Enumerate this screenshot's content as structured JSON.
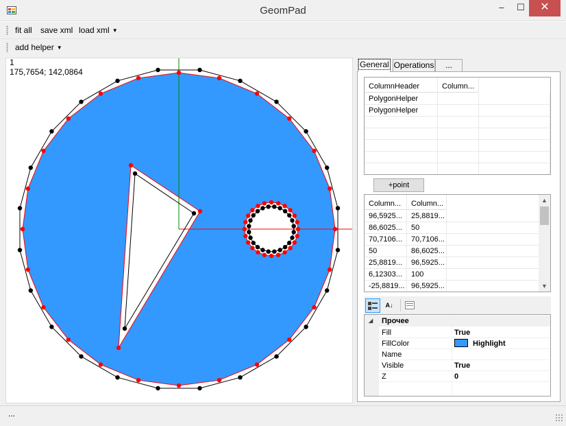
{
  "window": {
    "title": "GeomPad",
    "min_glyph": "–",
    "max_glyph": "☐",
    "close_glyph": "✕"
  },
  "toolbar1": {
    "fit_all": "fit all",
    "save_xml": "save xml",
    "load_xml": "load xml",
    "dropdown_glyph": "▼"
  },
  "toolbar2": {
    "add_helper": "add helper",
    "dropdown_glyph": "▼"
  },
  "canvas": {
    "info_line1": "1",
    "info_line2": "175,7654; 142,0864",
    "fill_color": "#3399ff",
    "outline_color": "#ff0000",
    "point_red": "#ff0000",
    "point_black": "#000000",
    "axis_x_color": "#ff0000",
    "axis_y_color": "#008000"
  },
  "tabs": [
    {
      "label": "General",
      "active": true
    },
    {
      "label": "Operations",
      "active": false
    },
    {
      "label": "...",
      "active": false
    }
  ],
  "helpers_grid": {
    "columns": [
      "ColumnHeader",
      "Column..."
    ],
    "rows": [
      [
        "PolygonHelper",
        ""
      ],
      [
        "PolygonHelper",
        ""
      ]
    ]
  },
  "add_point_button": "+point",
  "points_grid": {
    "columns": [
      "Column...",
      "Column..."
    ],
    "rows": [
      [
        "96,5925...",
        "25,8819..."
      ],
      [
        "86,6025...",
        "50"
      ],
      [
        "70,7106...",
        "70,7106..."
      ],
      [
        "50",
        "86,6025..."
      ],
      [
        "25,8819...",
        "96,5925..."
      ],
      [
        "6,12303...",
        "100"
      ],
      [
        "-25,8819...",
        "96,5925..."
      ]
    ]
  },
  "property_grid": {
    "toolbar_icons": [
      "categorized-icon",
      "alphabetical-icon",
      "property-pages-icon"
    ],
    "alpha_glyph": "A↓",
    "category": "Прочее",
    "expand_glyph": "◢",
    "properties": [
      {
        "name": "Fill",
        "value": "True",
        "swatch": false
      },
      {
        "name": "FillColor",
        "value": "Highlight",
        "swatch": true,
        "color": "#3399ff"
      },
      {
        "name": "Name",
        "value": "",
        "swatch": false
      },
      {
        "name": "Visible",
        "value": "True",
        "swatch": false
      },
      {
        "name": "Z",
        "value": "0",
        "swatch": false
      }
    ]
  },
  "status": {
    "text": "..."
  }
}
